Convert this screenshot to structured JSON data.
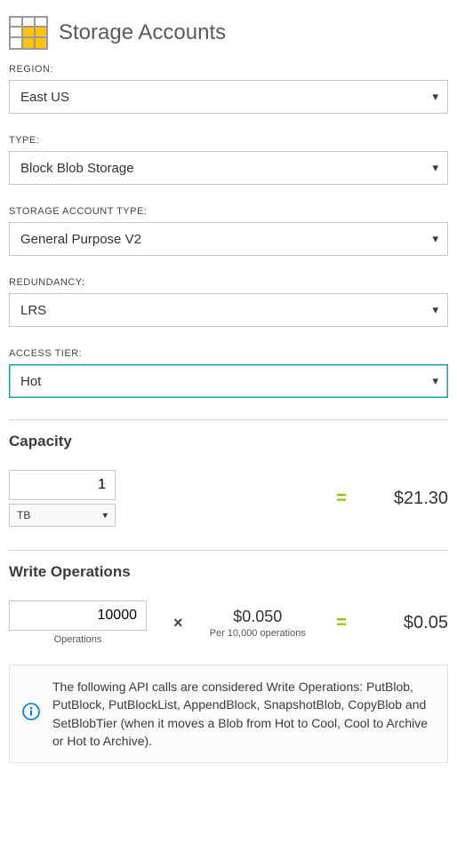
{
  "header": {
    "title": "Storage Accounts"
  },
  "fields": {
    "region": {
      "label": "REGION:",
      "value": "East US"
    },
    "type": {
      "label": "TYPE:",
      "value": "Block Blob Storage"
    },
    "acct_type": {
      "label": "STORAGE ACCOUNT TYPE:",
      "value": "General Purpose V2"
    },
    "redundancy": {
      "label": "REDUNDANCY:",
      "value": "LRS"
    },
    "access_tier": {
      "label": "ACCESS TIER:",
      "value": "Hot"
    }
  },
  "capacity": {
    "heading": "Capacity",
    "value": "1",
    "unit": "TB",
    "equals": "=",
    "price": "$21.30"
  },
  "write_ops": {
    "heading": "Write Operations",
    "value": "10000",
    "value_sub": "Operations",
    "times": "×",
    "rate": "$0.050",
    "rate_sub": "Per 10,000 operations",
    "equals": "=",
    "price": "$0.05",
    "info": "The following API calls are considered Write Operations: PutBlob, PutBlock, PutBlockList, AppendBlock, SnapshotBlob, CopyBlob and SetBlobTier (when it moves a Blob from Hot to Cool, Cool to Archive or Hot to Archive)."
  }
}
